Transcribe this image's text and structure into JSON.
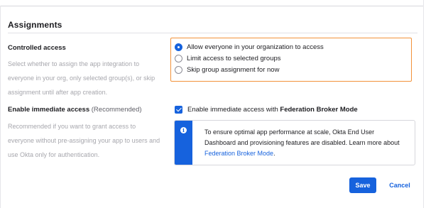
{
  "assignments": {
    "title": "Assignments",
    "controlled_access": {
      "label": "Controlled access",
      "help": "Select whether to assign the app integration to everyone in your org, only selected group(s), or skip assignment until after app creation.",
      "options": [
        {
          "label": "Allow everyone in your organization to access",
          "checked": true
        },
        {
          "label": "Limit access to selected groups",
          "checked": false
        },
        {
          "label": "Skip group assignment for now",
          "checked": false
        }
      ],
      "highlight_color": "#f29239"
    },
    "immediate_access": {
      "label": "Enable immediate access",
      "label_suffix": "(Recommended)",
      "help": "Recommended if you want to grant access to everyone without pre-assigning your app to users and use Okta only for authentication.",
      "checkbox_label_prefix": "Enable immediate access with ",
      "checkbox_label_bold": "Federation Broker Mode",
      "checked": true,
      "callout": {
        "icon": "info-icon",
        "text": "To ensure optimal app performance at scale, Okta End User Dashboard and provisioning features are disabled. Learn more about ",
        "link_text": "Federation Broker Mode",
        "text_end": "."
      }
    }
  },
  "actions": {
    "save_label": "Save",
    "cancel_label": "Cancel"
  },
  "colors": {
    "accent": "#1662dd",
    "text": "#1d1d21",
    "muted": "#a7a7ad"
  }
}
